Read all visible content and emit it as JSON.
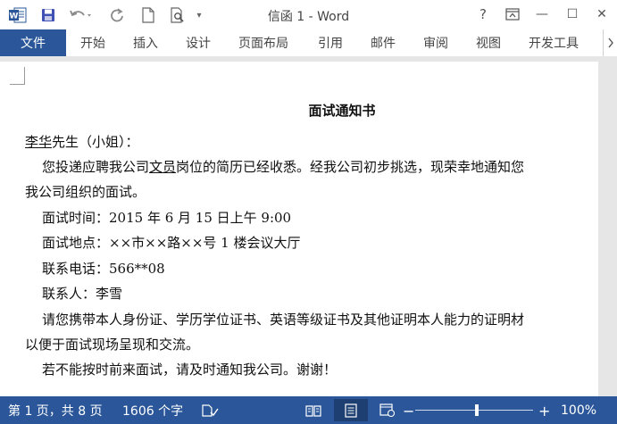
{
  "titlebar": {
    "title": "信函 1 - Word",
    "help": "?",
    "minimize": "—",
    "maximize": "☐",
    "close": "✕",
    "customize_qat": "▾"
  },
  "ribbon": {
    "file_tab": "文件",
    "tabs": [
      "开始",
      "插入",
      "设计",
      "页面布局",
      "引用",
      "邮件",
      "审阅",
      "视图",
      "开发工具"
    ]
  },
  "document": {
    "title": "面试通知书",
    "greeting_name": "李华",
    "greeting_rest": "先生（小姐）：",
    "p1_a": "您投递应聘我公司",
    "p1_job": "文员",
    "p1_b": "岗位的简历已经收悉。经我公司初步挑选，现荣幸地通知您",
    "p1_line2": "我公司组织的面试。",
    "time": "面试时间：2015 年 6 月 15 日上午 9:00",
    "place": "面试地点：××市××路××号 1 楼会议大厅",
    "phone": "联系电话：566**08",
    "contact": "联系人：李雪",
    "p2_line1": "请您携带本人身份证、学历学位证书、英语等级证书及其他证明本人能力的证明材",
    "p2_line2": "以便于面试现场呈现和交流。",
    "p3": "若不能按时前来面试，请及时通知我公司。谢谢！"
  },
  "statusbar": {
    "page": "第 1 页，共 8 页",
    "words": "1606 个字",
    "zoom_minus": "−",
    "zoom_plus": "+",
    "zoom_level": "100%",
    "zoom_fraction": 0.5
  },
  "colors": {
    "accent": "#2b579a"
  }
}
